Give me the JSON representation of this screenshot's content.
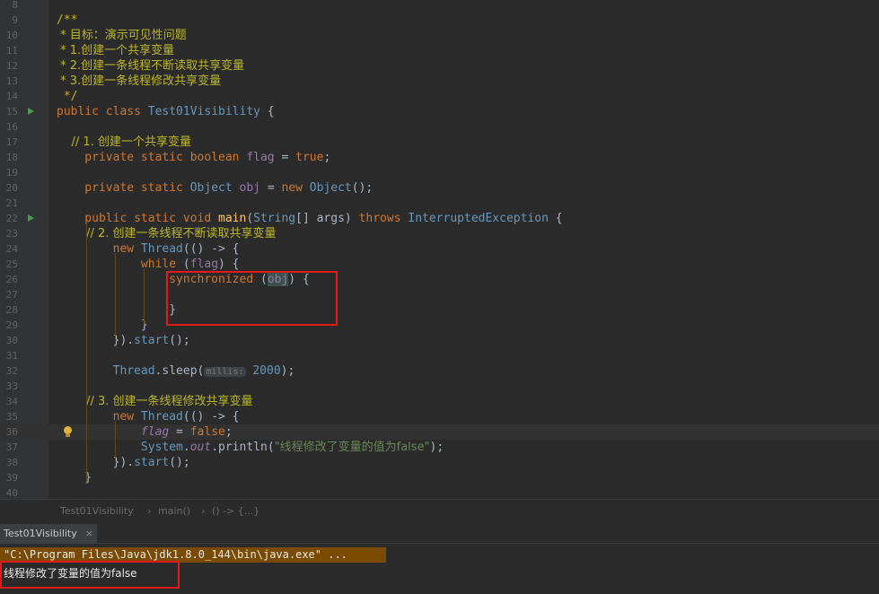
{
  "editor": {
    "lines": [
      {
        "n": "8",
        "segs": []
      },
      {
        "n": "9",
        "segs": [
          {
            "c": "cm",
            "t": "/**"
          }
        ]
      },
      {
        "n": "10",
        "segs": [
          {
            "c": "cm",
            "t": " * 目标：演示可见性问题"
          }
        ]
      },
      {
        "n": "11",
        "segs": [
          {
            "c": "cm",
            "t": " * 1.创建一个共享变量"
          }
        ]
      },
      {
        "n": "12",
        "segs": [
          {
            "c": "cm",
            "t": " * 2.创建一条线程不断读取共享变量"
          }
        ]
      },
      {
        "n": "13",
        "segs": [
          {
            "c": "cm",
            "t": " * 3.创建一条线程修改共享变量"
          }
        ]
      },
      {
        "n": "14",
        "segs": [
          {
            "c": "cm",
            "t": " */"
          }
        ]
      },
      {
        "n": "15",
        "run": true,
        "segs": [
          {
            "c": "kw",
            "t": "public class "
          },
          {
            "c": "cls",
            "t": "Test01Visibility"
          },
          {
            "c": "",
            "t": " {"
          }
        ]
      },
      {
        "n": "16",
        "segs": []
      },
      {
        "n": "17",
        "segs": [
          {
            "c": "cm",
            "t": "    // 1. 创建一个共享变量"
          }
        ]
      },
      {
        "n": "18",
        "segs": [
          {
            "c": "kw",
            "t": "    private static boolean "
          },
          {
            "c": "fld",
            "t": "flag"
          },
          {
            "c": "",
            "t": " = "
          },
          {
            "c": "kw",
            "t": "true"
          },
          {
            "c": "",
            "t": ";"
          }
        ]
      },
      {
        "n": "19",
        "segs": []
      },
      {
        "n": "20",
        "segs": [
          {
            "c": "kw",
            "t": "    private static "
          },
          {
            "c": "ty",
            "t": "Object"
          },
          {
            "c": "",
            "t": " "
          },
          {
            "c": "fld",
            "t": "obj"
          },
          {
            "c": "",
            "t": " = "
          },
          {
            "c": "kw",
            "t": "new "
          },
          {
            "c": "ty",
            "t": "Object"
          },
          {
            "c": "",
            "t": "();"
          }
        ]
      },
      {
        "n": "21",
        "segs": []
      },
      {
        "n": "22",
        "run": true,
        "segs": [
          {
            "c": "kw",
            "t": "    public static void "
          },
          {
            "c": "fn",
            "t": "main"
          },
          {
            "c": "",
            "t": "("
          },
          {
            "c": "ty",
            "t": "String"
          },
          {
            "c": "",
            "t": "[] args) "
          },
          {
            "c": "kw",
            "t": "throws "
          },
          {
            "c": "ty",
            "t": "InterruptedException"
          },
          {
            "c": "",
            "t": " {"
          }
        ]
      },
      {
        "n": "23",
        "segs": [
          {
            "c": "cm",
            "t": "        // 2. 创建一条线程不断读取共享变量"
          }
        ]
      },
      {
        "n": "24",
        "segs": [
          {
            "c": "kw",
            "t": "        new "
          },
          {
            "c": "ty",
            "t": "Thread"
          },
          {
            "c": "",
            "t": "(() -> {"
          }
        ]
      },
      {
        "n": "25",
        "segs": [
          {
            "c": "kw",
            "t": "            while "
          },
          {
            "c": "",
            "t": "("
          },
          {
            "c": "fld",
            "t": "flag"
          },
          {
            "c": "",
            "t": ") {"
          }
        ]
      },
      {
        "n": "26",
        "segs": [
          {
            "c": "kw",
            "t": "                synchronized "
          },
          {
            "c": "",
            "t": "("
          },
          {
            "c": "fld hl",
            "t": "obj"
          },
          {
            "c": "",
            "t": ") {"
          }
        ]
      },
      {
        "n": "27",
        "segs": []
      },
      {
        "n": "28",
        "segs": [
          {
            "c": "",
            "t": "                }"
          }
        ]
      },
      {
        "n": "29",
        "segs": [
          {
            "c": "",
            "t": "            }"
          }
        ]
      },
      {
        "n": "30",
        "segs": [
          {
            "c": "",
            "t": "        })."
          },
          {
            "c": "ty",
            "t": "start"
          },
          {
            "c": "",
            "t": "();"
          }
        ]
      },
      {
        "n": "31",
        "segs": []
      },
      {
        "n": "32",
        "segs": [
          {
            "c": "ty",
            "t": "        Thread"
          },
          {
            "c": "",
            "t": ".sleep("
          },
          {
            "c": "hint",
            "t": "millis:"
          },
          {
            "c": "",
            "t": " "
          },
          {
            "c": "num",
            "t": "2000"
          },
          {
            "c": "",
            "t": ");"
          }
        ]
      },
      {
        "n": "33",
        "segs": []
      },
      {
        "n": "34",
        "segs": [
          {
            "c": "cm",
            "t": "        // 3. 创建一条线程修改共享变量"
          }
        ]
      },
      {
        "n": "35",
        "segs": [
          {
            "c": "kw",
            "t": "        new "
          },
          {
            "c": "ty",
            "t": "Thread"
          },
          {
            "c": "",
            "t": "(() -> {"
          }
        ]
      },
      {
        "n": "36",
        "caret": true,
        "bulb": true,
        "segs": [
          {
            "c": "sfld",
            "t": "            flag"
          },
          {
            "c": "",
            "t": " = "
          },
          {
            "c": "kw",
            "t": "false"
          },
          {
            "c": "",
            "t": ";"
          }
        ]
      },
      {
        "n": "37",
        "segs": [
          {
            "c": "ty",
            "t": "            System"
          },
          {
            "c": "",
            "t": "."
          },
          {
            "c": "sfld",
            "t": "out"
          },
          {
            "c": "",
            "t": ".println("
          },
          {
            "c": "str",
            "t": "\"线程修改了变量的值为false\""
          },
          {
            "c": "",
            "t": ");"
          }
        ]
      },
      {
        "n": "38",
        "segs": [
          {
            "c": "",
            "t": "        })."
          },
          {
            "c": "ty",
            "t": "start"
          },
          {
            "c": "",
            "t": "();"
          }
        ]
      },
      {
        "n": "39",
        "segs": [
          {
            "c": "",
            "t": "    }"
          }
        ]
      },
      {
        "n": "40",
        "segs": []
      }
    ]
  },
  "breadcrumb": {
    "class_name": "Test01Visibility",
    "method": "main()",
    "lambda": "() -> {...}",
    "sep": "›"
  },
  "run": {
    "tab_title": "Test01Visibility",
    "close": "×",
    "command": "\"C:\\Program Files\\Java\\jdk1.8.0_144\\bin\\java.exe\" ...",
    "output": "线程修改了变量的值为false"
  }
}
